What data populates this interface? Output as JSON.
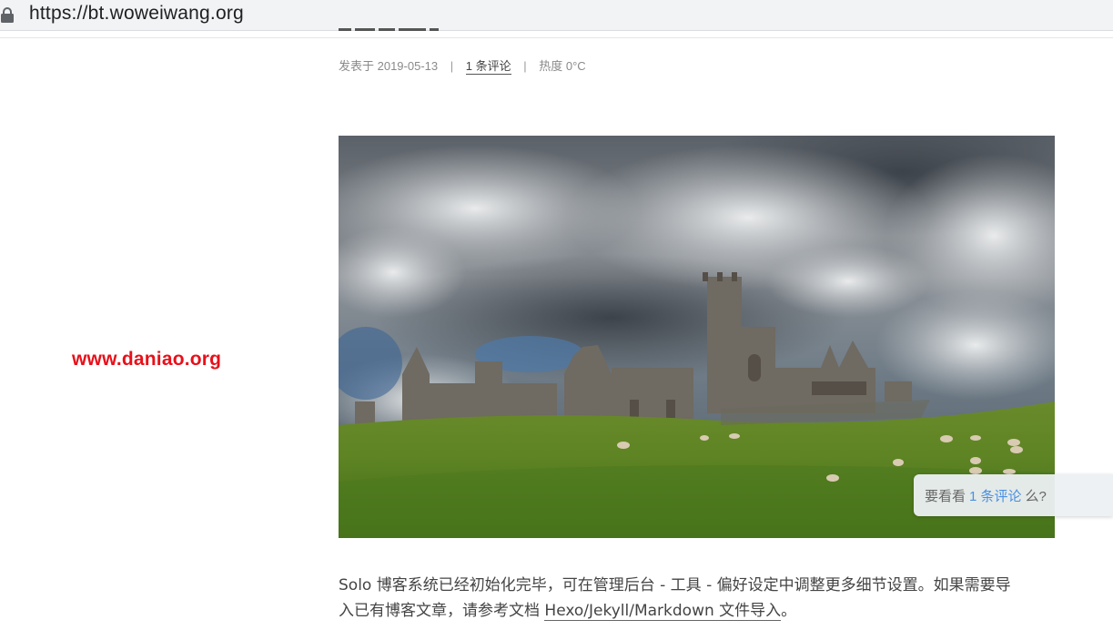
{
  "browser": {
    "url": "https://bt.woweiwang.org"
  },
  "meta": {
    "published": "发表于 2019-05-13",
    "separator": "|",
    "comments": "1 条评论",
    "heat": "热度 0°C"
  },
  "watermark": "www.daniao.org",
  "comment_hint": {
    "prefix": "要看看",
    "link": "1 条评论",
    "suffix": "么?"
  },
  "body": {
    "line1": "Solo 博客系统已经初始化完毕，可在管理后台 - 工具 - 偏好设定中调整更多细节设置。如果需要导",
    "line2_prefix": "入已有博客文章，请参考文档 ",
    "doc_link": "Hexo/Jekyll/Markdown 文件导入",
    "line2_suffix": "。"
  },
  "icons": {
    "lock": "lock-icon"
  }
}
